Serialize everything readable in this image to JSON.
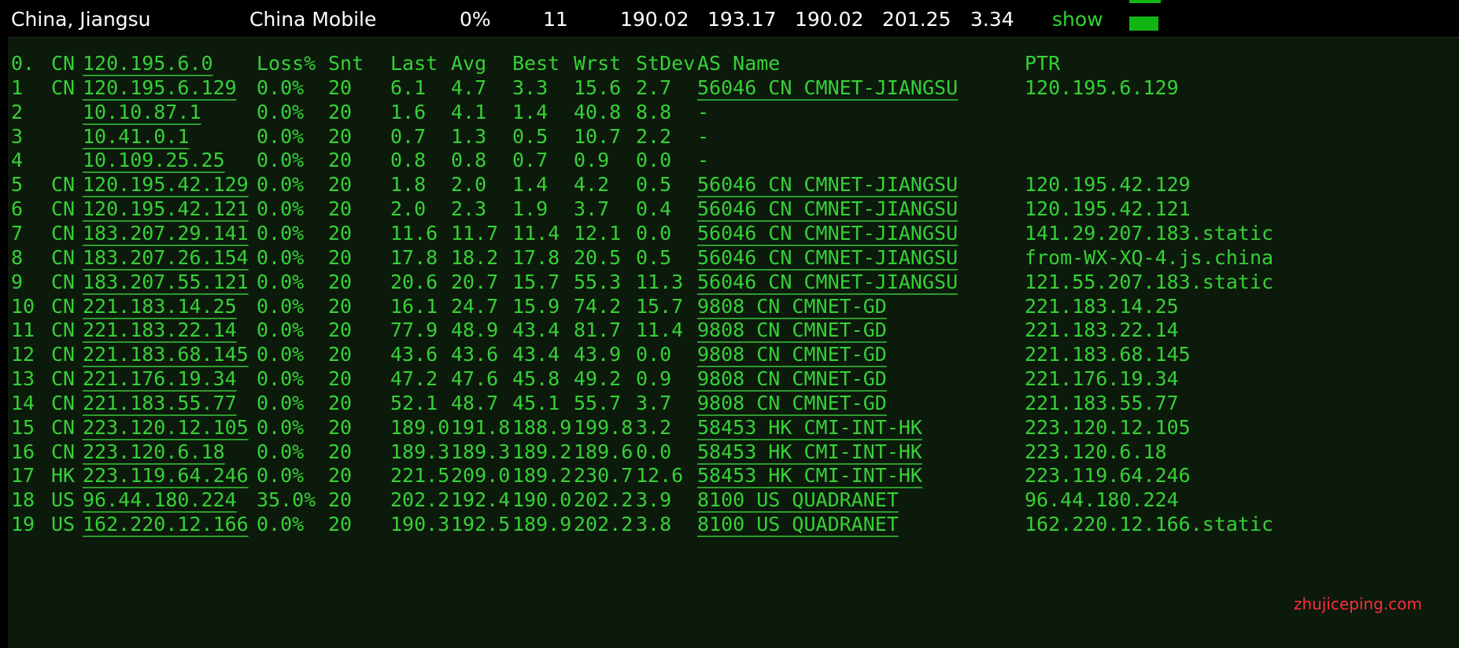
{
  "summary": {
    "location": "China, Jiangsu",
    "isp": "China Mobile",
    "loss": "0%",
    "hops": "11",
    "v1": "190.02",
    "v2": "193.17",
    "v3": "190.02",
    "v4": "201.25",
    "v5": "3.34",
    "show_label": "show",
    "bar_color": "#12b512"
  },
  "trace": {
    "headers": {
      "index": "0.",
      "cc": "CN",
      "ip": "120.195.6.0",
      "loss": "Loss%",
      "snt": "Snt",
      "last": "Last",
      "avg": "Avg",
      "best": "Best",
      "wrst": "Wrst",
      "stdev": "StDev",
      "as": "AS Name",
      "ptr": "PTR"
    },
    "rows": [
      {
        "n": "1",
        "cc": "CN",
        "ip": "120.195.6.129",
        "loss": "0.0%",
        "snt": "20",
        "last": "6.1",
        "avg": "4.7",
        "best": "3.3",
        "wrst": "15.6",
        "stdev": "2.7",
        "as": "56046 CN CMNET-JIANGSU",
        "ptr": "120.195.6.129"
      },
      {
        "n": "2",
        "cc": "",
        "ip": "10.10.87.1",
        "loss": "0.0%",
        "snt": "20",
        "last": "1.6",
        "avg": "4.1",
        "best": "1.4",
        "wrst": "40.8",
        "stdev": "8.8",
        "as": "-",
        "ptr": ""
      },
      {
        "n": "3",
        "cc": "",
        "ip": "10.41.0.1",
        "loss": "0.0%",
        "snt": "20",
        "last": "0.7",
        "avg": "1.3",
        "best": "0.5",
        "wrst": "10.7",
        "stdev": "2.2",
        "as": "-",
        "ptr": ""
      },
      {
        "n": "4",
        "cc": "",
        "ip": "10.109.25.25",
        "loss": "0.0%",
        "snt": "20",
        "last": "0.8",
        "avg": "0.8",
        "best": "0.7",
        "wrst": "0.9",
        "stdev": "0.0",
        "as": "-",
        "ptr": ""
      },
      {
        "n": "5",
        "cc": "CN",
        "ip": "120.195.42.129",
        "loss": "0.0%",
        "snt": "20",
        "last": "1.8",
        "avg": "2.0",
        "best": "1.4",
        "wrst": "4.2",
        "stdev": "0.5",
        "as": "56046 CN CMNET-JIANGSU",
        "ptr": "120.195.42.129"
      },
      {
        "n": "6",
        "cc": "CN",
        "ip": "120.195.42.121",
        "loss": "0.0%",
        "snt": "20",
        "last": "2.0",
        "avg": "2.3",
        "best": "1.9",
        "wrst": "3.7",
        "stdev": "0.4",
        "as": "56046 CN CMNET-JIANGSU",
        "ptr": "120.195.42.121"
      },
      {
        "n": "7",
        "cc": "CN",
        "ip": "183.207.29.141",
        "loss": "0.0%",
        "snt": "20",
        "last": "11.6",
        "avg": "11.7",
        "best": "11.4",
        "wrst": "12.1",
        "stdev": "0.0",
        "as": "56046 CN CMNET-JIANGSU",
        "ptr": "141.29.207.183.static"
      },
      {
        "n": "8",
        "cc": "CN",
        "ip": "183.207.26.154",
        "loss": "0.0%",
        "snt": "20",
        "last": "17.8",
        "avg": "18.2",
        "best": "17.8",
        "wrst": "20.5",
        "stdev": "0.5",
        "as": "56046 CN CMNET-JIANGSU",
        "ptr": "from-WX-XQ-4.js.china"
      },
      {
        "n": "9",
        "cc": "CN",
        "ip": "183.207.55.121",
        "loss": "0.0%",
        "snt": "20",
        "last": "20.6",
        "avg": "20.7",
        "best": "15.7",
        "wrst": "55.3",
        "stdev": "11.3",
        "as": "56046 CN CMNET-JIANGSU",
        "ptr": "121.55.207.183.static"
      },
      {
        "n": "10",
        "cc": "CN",
        "ip": "221.183.14.25",
        "loss": "0.0%",
        "snt": "20",
        "last": "16.1",
        "avg": "24.7",
        "best": "15.9",
        "wrst": "74.2",
        "stdev": "15.7",
        "as": "9808  CN CMNET-GD",
        "ptr": "221.183.14.25"
      },
      {
        "n": "11",
        "cc": "CN",
        "ip": "221.183.22.14",
        "loss": "0.0%",
        "snt": "20",
        "last": "77.9",
        "avg": "48.9",
        "best": "43.4",
        "wrst": "81.7",
        "stdev": "11.4",
        "as": "9808  CN CMNET-GD",
        "ptr": "221.183.22.14"
      },
      {
        "n": "12",
        "cc": "CN",
        "ip": "221.183.68.145",
        "loss": "0.0%",
        "snt": "20",
        "last": "43.6",
        "avg": "43.6",
        "best": "43.4",
        "wrst": "43.9",
        "stdev": "0.0",
        "as": "9808  CN CMNET-GD",
        "ptr": "221.183.68.145"
      },
      {
        "n": "13",
        "cc": "CN",
        "ip": "221.176.19.34",
        "loss": "0.0%",
        "snt": "20",
        "last": "47.2",
        "avg": "47.6",
        "best": "45.8",
        "wrst": "49.2",
        "stdev": "0.9",
        "as": "9808  CN CMNET-GD",
        "ptr": "221.176.19.34"
      },
      {
        "n": "14",
        "cc": "CN",
        "ip": "221.183.55.77",
        "loss": "0.0%",
        "snt": "20",
        "last": "52.1",
        "avg": "48.7",
        "best": "45.1",
        "wrst": "55.7",
        "stdev": "3.7",
        "as": "9808  CN CMNET-GD",
        "ptr": "221.183.55.77"
      },
      {
        "n": "15",
        "cc": "CN",
        "ip": "223.120.12.105",
        "loss": "0.0%",
        "snt": "20",
        "last": "189.0",
        "avg": "191.8",
        "best": "188.9",
        "wrst": "199.8",
        "stdev": "3.2",
        "as": "58453 HK CMI-INT-HK",
        "ptr": "223.120.12.105"
      },
      {
        "n": "16",
        "cc": "CN",
        "ip": "223.120.6.18",
        "loss": "0.0%",
        "snt": "20",
        "last": "189.3",
        "avg": "189.3",
        "best": "189.2",
        "wrst": "189.6",
        "stdev": "0.0",
        "as": "58453 HK CMI-INT-HK",
        "ptr": "223.120.6.18"
      },
      {
        "n": "17",
        "cc": "HK",
        "ip": "223.119.64.246",
        "loss": "0.0%",
        "snt": "20",
        "last": "221.5",
        "avg": "209.0",
        "best": "189.2",
        "wrst": "230.7",
        "stdev": "12.6",
        "as": "58453 HK CMI-INT-HK",
        "ptr": "223.119.64.246"
      },
      {
        "n": "18",
        "cc": "US",
        "ip": "96.44.180.224",
        "loss": "35.0%",
        "snt": "20",
        "last": "202.2",
        "avg": "192.4",
        "best": "190.0",
        "wrst": "202.2",
        "stdev": "3.9",
        "as": "8100  US QUADRANET",
        "ptr": "96.44.180.224"
      },
      {
        "n": "19",
        "cc": "US",
        "ip": "162.220.12.166",
        "loss": "0.0%",
        "snt": "20",
        "last": "190.3",
        "avg": "192.5",
        "best": "189.9",
        "wrst": "202.2",
        "stdev": "3.8",
        "as": "8100  US QUADRANET",
        "ptr": "162.220.12.166.static"
      }
    ]
  },
  "watermark": "zhujiceping.com"
}
